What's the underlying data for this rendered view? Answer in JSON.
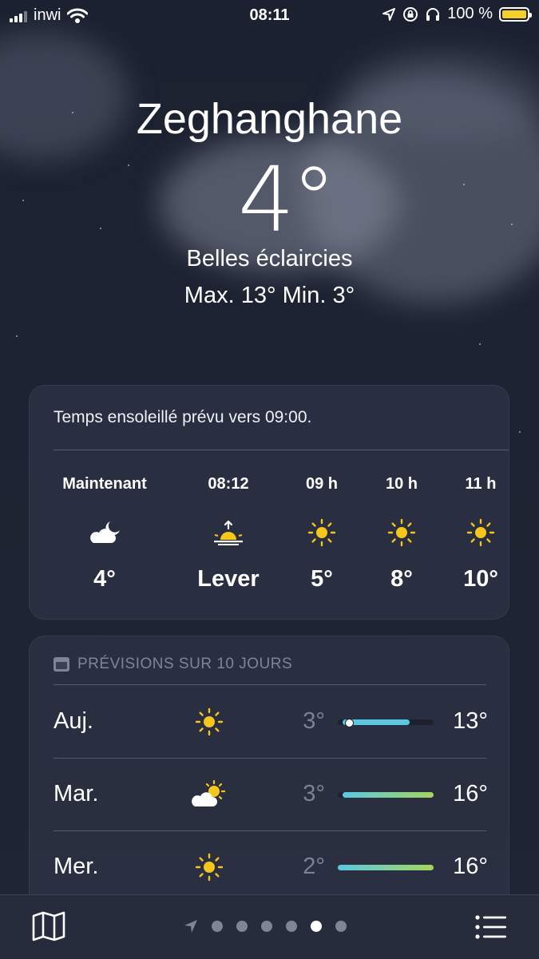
{
  "status_bar": {
    "carrier": "inwi",
    "time": "08:11",
    "battery": "100 %"
  },
  "location": {
    "city": "Zeghanghane",
    "temperature": "4°",
    "condition": "Belles éclaircies",
    "high_low": "Max. 13°  Min. 3°"
  },
  "hourly": {
    "summary": "Temps ensoleillé prévu vers 09:00.",
    "items": [
      {
        "hour": "Maintenant",
        "icon": "partly-cloudy-night-icon",
        "value": "4°"
      },
      {
        "hour": "08:12",
        "icon": "sunrise-icon",
        "value": "Lever"
      },
      {
        "hour": "09 h",
        "icon": "sun-icon",
        "value": "5°"
      },
      {
        "hour": "10 h",
        "icon": "sun-icon",
        "value": "8°"
      },
      {
        "hour": "11 h",
        "icon": "sun-icon",
        "value": "10°"
      }
    ]
  },
  "daily": {
    "header": "PRÉVISIONS SUR 10 JOURS",
    "days": [
      {
        "day": "Auj.",
        "icon": "sun-icon",
        "low": "3°",
        "high": "13°",
        "range_start": 0.05,
        "range_end": 0.75,
        "current_marker": 0.12
      },
      {
        "day": "Mar.",
        "icon": "partly-cloudy-day-icon",
        "low": "3°",
        "high": "16°",
        "range_start": 0.05,
        "range_end": 1.0
      },
      {
        "day": "Mer.",
        "icon": "sun-icon",
        "low": "2°",
        "high": "16°",
        "range_start": 0.0,
        "range_end": 1.0
      }
    ]
  },
  "bottom_bar": {
    "page_count": 6,
    "active_page": 5
  },
  "colors": {
    "sun": "#f7c61a",
    "range_cool": "#5ac8e0",
    "range_warm": "#a4d65e"
  }
}
